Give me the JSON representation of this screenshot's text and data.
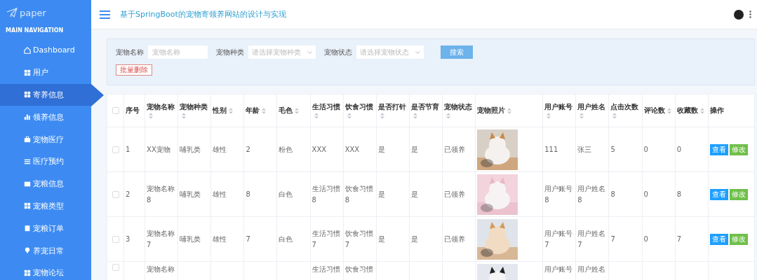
{
  "sidebar": {
    "logo": "paper",
    "section": "MAIN NAVIGATION",
    "items": [
      {
        "label": "Dashboard",
        "selected": false
      },
      {
        "label": "用户",
        "selected": false
      },
      {
        "label": "寄养信息",
        "selected": true
      },
      {
        "label": "领养信息",
        "selected": false
      },
      {
        "label": "宠物医疗",
        "selected": false
      },
      {
        "label": "医疗预约",
        "selected": false
      },
      {
        "label": "宠粮信息",
        "selected": false
      },
      {
        "label": "宠粮类型",
        "selected": false
      },
      {
        "label": "宠粮订单",
        "selected": false
      },
      {
        "label": "养宠日常",
        "selected": false
      },
      {
        "label": "宠物论坛",
        "selected": false
      }
    ]
  },
  "header": {
    "title": "基于SpringBoot的宠物寄领养网站的设计与实现"
  },
  "search": {
    "fields": [
      {
        "kind": "input",
        "label": "宠物名称",
        "placeholder": "宠物名称"
      },
      {
        "kind": "select",
        "label": "宠物种类",
        "placeholder": "请选择宠物种类"
      },
      {
        "kind": "select",
        "label": "宠物状态",
        "placeholder": "请选择宠物状态"
      }
    ],
    "search_button": "搜索",
    "delete_button": "批量删除"
  },
  "table": {
    "select_all_checked": false,
    "columns": [
      {
        "label": "序号",
        "sortable": false
      },
      {
        "label": "宠物名称",
        "sortable": true
      },
      {
        "label": "宠物种类",
        "sortable": true
      },
      {
        "label": "性别",
        "sortable": true
      },
      {
        "label": "年龄",
        "sortable": true
      },
      {
        "label": "毛色",
        "sortable": true
      },
      {
        "label": "生活习惯",
        "sortable": true
      },
      {
        "label": "饮食习惯",
        "sortable": true
      },
      {
        "label": "是否打针",
        "sortable": true
      },
      {
        "label": "是否节育",
        "sortable": true
      },
      {
        "label": "宠物状态",
        "sortable": true
      },
      {
        "label": "宠物照片",
        "sortable": true
      },
      {
        "label": "用户账号",
        "sortable": true
      },
      {
        "label": "用户姓名",
        "sortable": true
      },
      {
        "label": "点击次数",
        "sortable": true
      },
      {
        "label": "评论数",
        "sortable": true
      },
      {
        "label": "收藏数",
        "sortable": true
      },
      {
        "label": "操作",
        "sortable": false
      }
    ],
    "rows": [
      {
        "checked": false,
        "cells": [
          "1",
          "XX宠物",
          "哺乳类",
          "雄性",
          "2",
          "粉色",
          "XXX",
          "XXX",
          "是",
          "是",
          "已领养",
          {
            "kind": "picture"
          },
          "111",
          "张三",
          "5",
          "0",
          "0"
        ],
        "actions": [
          "查看",
          "修改"
        ]
      },
      {
        "checked": false,
        "cells": [
          "2",
          "宠物名称8",
          "哺乳类",
          "雄性",
          "8",
          "白色",
          "生活习惯8",
          "饮食习惯8",
          "是",
          "是",
          "已领养",
          {
            "kind": "picture"
          },
          "用户账号8",
          "用户姓名8",
          "8",
          "0",
          "8"
        ],
        "actions": [
          "查看",
          "修改"
        ]
      },
      {
        "checked": false,
        "cells": [
          "3",
          "宠物名称7",
          "哺乳类",
          "雄性",
          "7",
          "白色",
          "生活习惯7",
          "饮食习惯7",
          "是",
          "是",
          "已领养",
          {
            "kind": "picture"
          },
          "用户账号7",
          "用户姓名7",
          "7",
          "0",
          "7"
        ],
        "actions": [
          "查看",
          "修改"
        ]
      },
      {
        "checked": false,
        "cells": [
          null,
          "宠物名称",
          null,
          null,
          null,
          null,
          "生活习惯",
          "饮食习惯",
          null,
          null,
          null,
          {
            "kind": "picture"
          },
          "用户账号",
          "用户姓名",
          null,
          null,
          null
        ]
      }
    ]
  }
}
